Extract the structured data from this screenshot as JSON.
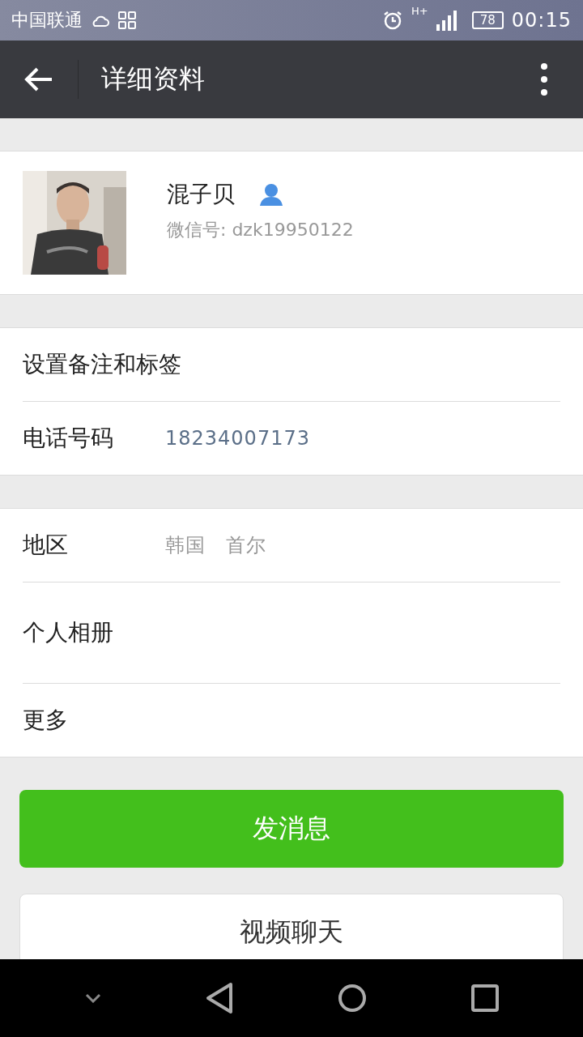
{
  "status_bar": {
    "carrier": "中国联通",
    "network": "H+",
    "battery": "78",
    "time": "00:15"
  },
  "header": {
    "title": "详细资料"
  },
  "profile": {
    "name": "混子贝",
    "wechat_id": "微信号: dzk19950122"
  },
  "groups": [
    [
      {
        "label": "设置备注和标签"
      },
      {
        "label": "电话号码",
        "value": "18234007173",
        "kind": "link"
      }
    ],
    [
      {
        "label": "地区",
        "value": "韩国　首尔",
        "kind": "plain"
      },
      {
        "label": "个人相册",
        "tall": true
      },
      {
        "label": "更多"
      }
    ]
  ],
  "buttons": [
    {
      "label": "发消息",
      "kind": "primary"
    },
    {
      "label": "视频聊天",
      "kind": "secondary"
    }
  ]
}
